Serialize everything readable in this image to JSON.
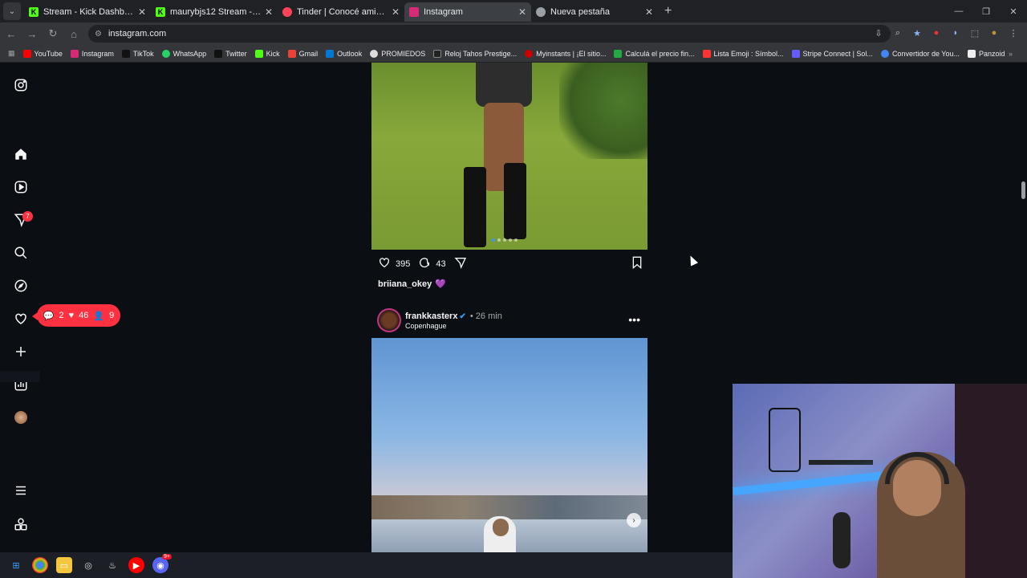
{
  "browser": {
    "tabs": [
      {
        "title": "Stream - Kick Dashboard",
        "favicon_color": "#53fc18",
        "favicon": "K"
      },
      {
        "title": "maurybjs12 Stream - Watch Live",
        "favicon_color": "#53fc18",
        "favicon": "K"
      },
      {
        "title": "Tinder | Conocé amigos y gente",
        "favicon_color": "#ff4458",
        "favicon": ""
      },
      {
        "title": "Instagram",
        "favicon_color": "#d62976",
        "favicon": ""
      },
      {
        "title": "Nueva pestaña",
        "favicon_color": "#9aa0a6",
        "favicon": ""
      }
    ],
    "active_tab": 3,
    "new_tab_symbol": "+",
    "url": "instagram.com",
    "window_controls": [
      "—",
      "❐",
      "✕"
    ],
    "bookmarks": [
      {
        "label": "YouTube",
        "color": "#ff0000"
      },
      {
        "label": "Instagram",
        "color": "#d62976"
      },
      {
        "label": "TikTok",
        "color": "#111111"
      },
      {
        "label": "WhatsApp",
        "color": "#25d366"
      },
      {
        "label": "Twitter",
        "color": "#111111"
      },
      {
        "label": "Kick",
        "color": "#53fc18"
      },
      {
        "label": "Gmail",
        "color": "#ea4335"
      },
      {
        "label": "Outlook",
        "color": "#0078d4"
      },
      {
        "label": "PROMIEDOS",
        "color": "#dddddd"
      },
      {
        "label": "Reloj Tahos Prestige...",
        "color": "#222222"
      },
      {
        "label": "Myinstants | ¡El sitio...",
        "color": "#cc0000"
      },
      {
        "label": "Calculá el precio fin...",
        "color": "#22aa44"
      },
      {
        "label": "Lista Emoji : Símbol...",
        "color": "#ff3333"
      },
      {
        "label": "Stripe Connect | Sol...",
        "color": "#635bff"
      },
      {
        "label": "Convertidor de You...",
        "color": "#4285f4"
      },
      {
        "label": "Panzoid",
        "color": "#eeeeee"
      }
    ]
  },
  "sidebar": {
    "messages_badge": "7",
    "notification_popup": {
      "comments": "2",
      "likes": "46",
      "follows": "9"
    }
  },
  "post1": {
    "likes": "395",
    "comments": "43",
    "caption_user": "briiana_okey",
    "caption_emoji": "💜"
  },
  "post2": {
    "username": "frankkasterx",
    "time": "• 26 min",
    "location": "Copenhague"
  },
  "taskbar": {
    "discord_badge": "9+"
  }
}
